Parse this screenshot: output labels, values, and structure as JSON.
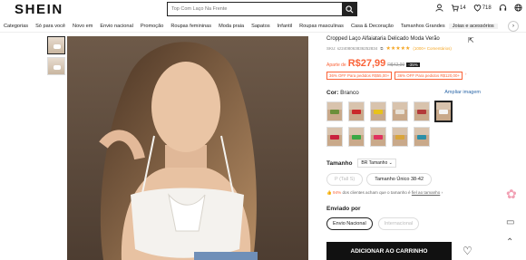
{
  "header": {
    "logo": "SHEIN",
    "search_placeholder": "Top Com Laço Na Frente",
    "cart_count": "14",
    "wish_count": "718"
  },
  "nav": {
    "items": [
      "Categorias",
      "Só para você",
      "Novo em",
      "Envio nacional",
      "Promoção",
      "Roupas femininas",
      "Moda praia",
      "Sapatos",
      "Infantil",
      "Roupas masculinas",
      "Casa & Decoração",
      "Tamanhos Grandes",
      "Joias e acessórios"
    ]
  },
  "product": {
    "title": "Cropped Laço Alfaiataria Delicado Moda Verão",
    "sku": "SKU: sz2408063836252834",
    "rating_stars": "★★★★★",
    "reviews": "(1000+ Comentários)",
    "price_from": "Aparte de",
    "price": "R$27,99",
    "old_price": "R$42,99",
    "discount": "-35%",
    "coupons": [
      "36% OFF Para pedidos R$55,00+",
      "36% OFF Para pedidos R$120,00+"
    ],
    "color_label": "Cor:",
    "color_value": "Branco",
    "zoom_link": "Ampliar imagem",
    "size_label": "Tamanho",
    "size_region": "BR Tamanho",
    "sizes": [
      "P (Tall S)",
      "Tamanho Único 38-42"
    ],
    "fit_percent": "94%",
    "fit_text": "dos clientes acham que o tamanho é",
    "fit_link": "fiel ao tamanho",
    "ship_label": "Enviado por",
    "ship_options": [
      "Envio Nacional",
      "Internacional"
    ],
    "add_to_cart": "ADICIONAR AO CARRINHO"
  },
  "swatches": [
    {
      "color": "#6b8f3a"
    },
    {
      "color": "#c92a2a"
    },
    {
      "color": "#e8c21a"
    },
    {
      "color": "#e8e1d6"
    },
    {
      "color": "#b33a3a"
    },
    {
      "color": "#f4f4f4"
    },
    {
      "color": "#c9213e"
    },
    {
      "color": "#3aa845"
    },
    {
      "color": "#e0325f"
    },
    {
      "color": "#d9a53a"
    },
    {
      "color": "#2b8fa8"
    }
  ],
  "accent": "#fa6338"
}
